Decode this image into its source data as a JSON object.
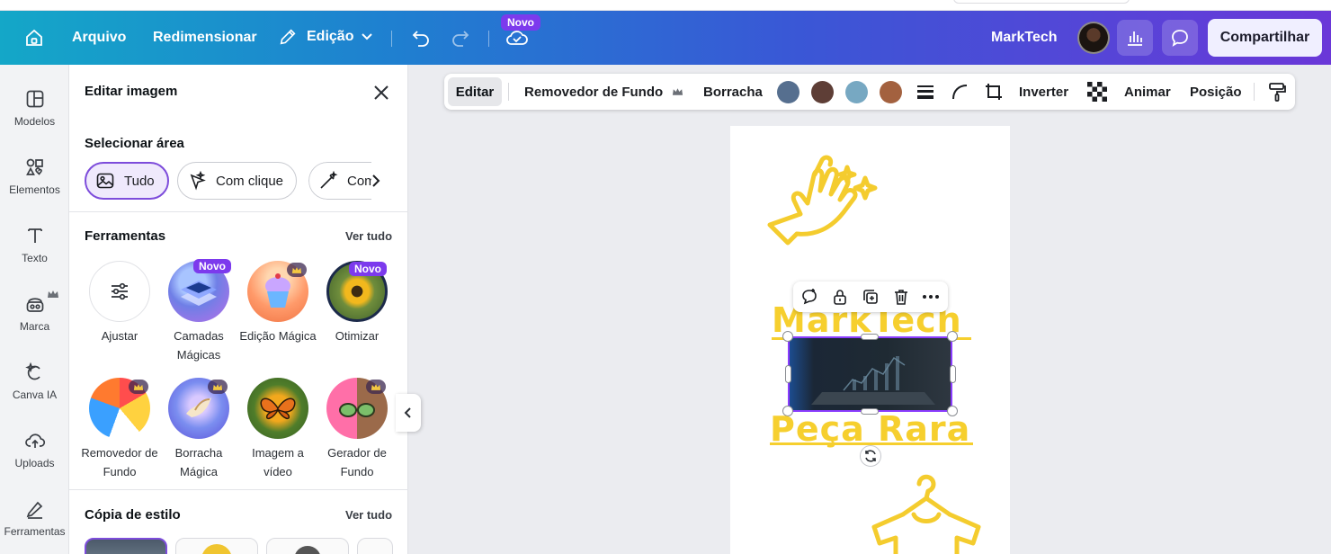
{
  "header": {
    "home_icon": "home-icon",
    "file_label": "Arquivo",
    "resize_label": "Redimensionar",
    "edit_label": "Edição",
    "novo_tag": "Novo",
    "brand_name": "MarkTech",
    "share_label": "Compartilhar",
    "gradient": [
      "#14a7c8",
      "#3a57d6",
      "#6a37d8"
    ]
  },
  "rail": {
    "items": [
      {
        "label": "Modelos",
        "icon": "templates-icon"
      },
      {
        "label": "Elementos",
        "icon": "elements-icon"
      },
      {
        "label": "Texto",
        "icon": "text-icon"
      },
      {
        "label": "Marca",
        "icon": "brand-icon"
      },
      {
        "label": "Canva IA",
        "icon": "ai-icon"
      },
      {
        "label": "Uploads",
        "icon": "upload-icon"
      },
      {
        "label": "Ferramentas",
        "icon": "tools-icon"
      }
    ]
  },
  "panel": {
    "title": "Editar imagem",
    "select_area_label": "Selecionar área",
    "chips": [
      "Tudo",
      "Com clique",
      "Com"
    ],
    "tools_label": "Ferramentas",
    "see_all": "Ver tudo",
    "tools": [
      {
        "label": "Ajustar",
        "badge": ""
      },
      {
        "label": "Camadas Mágicas",
        "badge": "Novo"
      },
      {
        "label": "Edição Mágica",
        "badge": "crown"
      },
      {
        "label": "Otimizar",
        "badge": "Novo"
      },
      {
        "label": "Removedor de Fundo",
        "badge": "crown"
      },
      {
        "label": "Borracha Mágica",
        "badge": "crown"
      },
      {
        "label": "Imagem a vídeo",
        "badge": ""
      },
      {
        "label": "Gerador de Fundo",
        "badge": "crown"
      }
    ],
    "style_copy_label": "Cópia de estilo",
    "style_see_all": "Ver tudo"
  },
  "context_toolbar": {
    "edit": "Editar",
    "bg_remover": "Removedor de Fundo",
    "eraser": "Borracha",
    "swatches": [
      "#566f8f",
      "#5e3e36",
      "#77a8c2",
      "#a3613f"
    ],
    "flip": "Inverter",
    "animate": "Animar",
    "position": "Posição"
  },
  "canvas": {
    "title_text": "MarkTech",
    "subtitle_text": "Peça Rara",
    "accent": "#f6cf2e"
  }
}
